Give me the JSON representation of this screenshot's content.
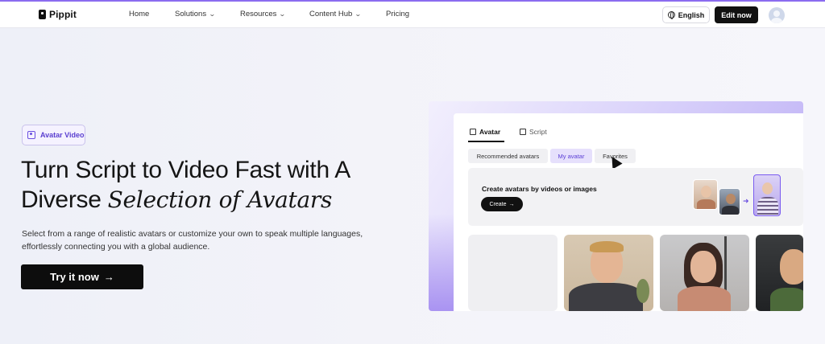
{
  "nav": {
    "brand": "Pippit",
    "items": [
      {
        "label": "Home",
        "dropdown": false
      },
      {
        "label": "Solutions",
        "dropdown": true
      },
      {
        "label": "Resources",
        "dropdown": true
      },
      {
        "label": "Content Hub",
        "dropdown": true
      },
      {
        "label": "Pricing",
        "dropdown": false
      }
    ],
    "language": "English",
    "cta": "Edit now"
  },
  "hero": {
    "badge": "Avatar Video",
    "title_plain": "Turn Script to Video Fast with A Diverse",
    "title_emphasis": "Selection of Avatars",
    "description": "Select from a range of realistic avatars or customize your own to speak multiple languages, effortlessly connecting you with a global audience.",
    "cta": "Try it now",
    "cta_icon": "arrow-right-icon"
  },
  "preview": {
    "tabs": [
      "Avatar",
      "Script"
    ],
    "active_tab": "Avatar",
    "chips": [
      "Recommended avatars",
      "My avatar",
      "Favorites"
    ],
    "active_chip": "My avatar",
    "create_card": {
      "title": "Create avatars by videos or images",
      "button": "Create"
    }
  },
  "colors": {
    "accent": "#8b6cf0",
    "dark": "#0d0d0d"
  }
}
